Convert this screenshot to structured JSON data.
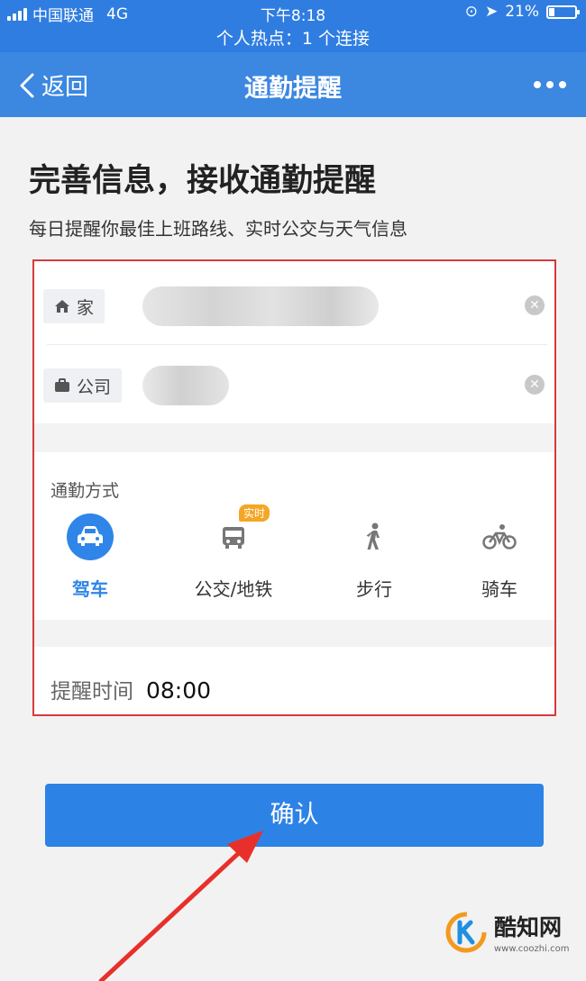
{
  "status_bar": {
    "carrier": "中国联通",
    "network": "4G",
    "time": "下午8:18",
    "battery_percent_text": "21%",
    "battery_level": 0.21
  },
  "hotspot_banner": "个人热点：1 个连接",
  "nav": {
    "back_label": "返回",
    "title": "通勤提醒"
  },
  "heading": {
    "title": "完善信息，接收通勤提醒",
    "subtitle": "每日提醒你最佳上班路线、实时公交与天气信息"
  },
  "addresses": [
    {
      "tag": "家",
      "icon": "home-icon"
    },
    {
      "tag": "公司",
      "icon": "briefcase-icon"
    }
  ],
  "commute": {
    "label": "通勤方式",
    "modes": [
      {
        "label": "驾车",
        "icon": "car-icon",
        "active": true
      },
      {
        "label": "公交/地铁",
        "icon": "bus-icon",
        "badge": "实时",
        "active": false
      },
      {
        "label": "步行",
        "icon": "walk-icon",
        "active": false
      },
      {
        "label": "骑车",
        "icon": "bike-icon",
        "active": false
      }
    ]
  },
  "reminder": {
    "label": "提醒时间",
    "time": "08:00"
  },
  "confirm_label": "确认",
  "watermark": {
    "name": "酷知网",
    "url": "www.coozhi.com"
  },
  "colors": {
    "primary_blue": "#2f7de1",
    "highlight_red": "#d63a3a",
    "badge_orange": "#f5a623"
  }
}
